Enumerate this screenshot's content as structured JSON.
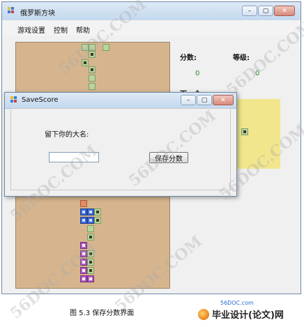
{
  "main_window": {
    "title": "俄罗斯方块",
    "controls": {
      "minimize": "–",
      "maximize": "▢",
      "close": "✕"
    }
  },
  "menu": {
    "items": [
      "游戏设置",
      "控制",
      "帮助"
    ]
  },
  "side_panel": {
    "score_label": "分数:",
    "score_value": "0",
    "level_label": "等级:",
    "level_value": "0",
    "next_label": "下一个:"
  },
  "dialog": {
    "title": "SaveScore",
    "controls": {
      "minimize": "–",
      "maximize": "▢",
      "close": "✕"
    },
    "prompt": "留下你的大名:",
    "name_value": "",
    "save_button": "保存分数"
  },
  "caption": "图 5.3 保存分数界面",
  "brand": {
    "site": "56DOC.com",
    "name": "毕业设计(论文)网"
  },
  "watermark": "56DOC.COM",
  "colors": {
    "board": "#d6b58e",
    "score_value": "#2a8a2a",
    "preview_bg": "#f2e68c"
  }
}
